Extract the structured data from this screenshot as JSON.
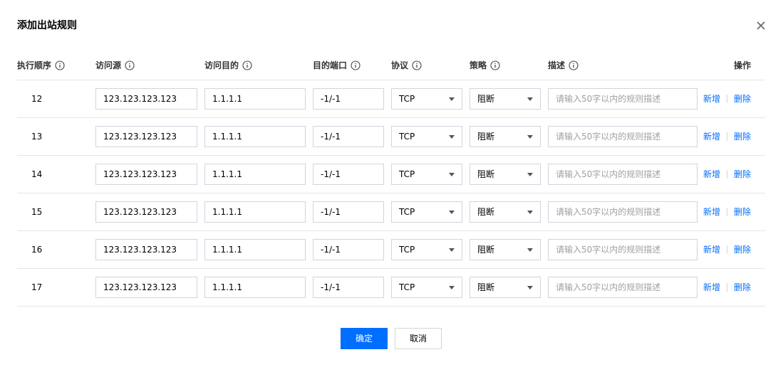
{
  "dialog": {
    "title": "添加出站规则",
    "close_icon": "close-icon"
  },
  "columns": [
    {
      "label": "执行顺序",
      "has_info": true
    },
    {
      "label": "访问源",
      "has_info": true
    },
    {
      "label": "访问目的",
      "has_info": true
    },
    {
      "label": "目的端口",
      "has_info": true
    },
    {
      "label": "协议",
      "has_info": true
    },
    {
      "label": "策略",
      "has_info": true
    },
    {
      "label": "描述",
      "has_info": true
    },
    {
      "label": "操作",
      "has_info": false
    }
  ],
  "rows": [
    {
      "order": "12",
      "source": "123.123.123.123",
      "destination": "1.1.1.1",
      "port": "-1/-1",
      "protocol": "TCP",
      "policy": "阻断",
      "description": "",
      "add_label": "新增",
      "delete_label": "删除"
    },
    {
      "order": "13",
      "source": "123.123.123.123",
      "destination": "1.1.1.1",
      "port": "-1/-1",
      "protocol": "TCP",
      "policy": "阻断",
      "description": "",
      "add_label": "新增",
      "delete_label": "删除"
    },
    {
      "order": "14",
      "source": "123.123.123.123",
      "destination": "1.1.1.1",
      "port": "-1/-1",
      "protocol": "TCP",
      "policy": "阻断",
      "description": "",
      "add_label": "新增",
      "delete_label": "删除"
    },
    {
      "order": "15",
      "source": "123.123.123.123",
      "destination": "1.1.1.1",
      "port": "-1/-1",
      "protocol": "TCP",
      "policy": "阻断",
      "description": "",
      "add_label": "新增",
      "delete_label": "删除"
    },
    {
      "order": "16",
      "source": "123.123.123.123",
      "destination": "1.1.1.1",
      "port": "-1/-1",
      "protocol": "TCP",
      "policy": "阻断",
      "description": "",
      "add_label": "新增",
      "delete_label": "删除"
    },
    {
      "order": "17",
      "source": "123.123.123.123",
      "destination": "1.1.1.1",
      "port": "-1/-1",
      "protocol": "TCP",
      "policy": "阻断",
      "description": "",
      "add_label": "新增",
      "delete_label": "删除"
    }
  ],
  "description_placeholder": "请输入50字以内的规则描述",
  "footer": {
    "confirm_label": "确定",
    "cancel_label": "取消"
  },
  "colors": {
    "primary": "#006eff",
    "border": "#cfd5de",
    "divider": "#e5e5e5"
  }
}
